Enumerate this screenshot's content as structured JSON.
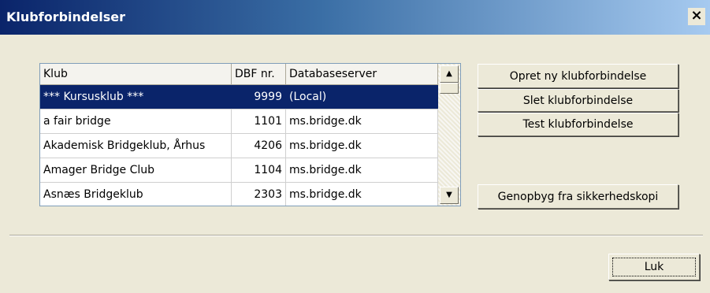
{
  "window": {
    "title": "Klubforbindelser",
    "close_glyph": "×"
  },
  "list": {
    "headers": [
      "Klub",
      "DBF nr.",
      "Databaseserver"
    ],
    "rows": [
      {
        "klub": "*** Kursusklub ***",
        "dbf": "9999",
        "server": "(Local)"
      },
      {
        "klub": "a fair bridge",
        "dbf": "1101",
        "server": "ms.bridge.dk"
      },
      {
        "klub": "Akademisk Bridgeklub, Århus",
        "dbf": "4206",
        "server": "ms.bridge.dk"
      },
      {
        "klub": "Amager Bridge Club",
        "dbf": "1104",
        "server": "ms.bridge.dk"
      },
      {
        "klub": "Asnæs Bridgeklub",
        "dbf": "2303",
        "server": "ms.bridge.dk"
      }
    ],
    "selected_index": 0
  },
  "buttons": {
    "create": "Opret ny klubforbindelse",
    "delete": "Slet klubforbindelse",
    "test": "Test klubforbindelse",
    "rebuild": "Genopbyg fra sikkerhedskopi",
    "close": "Luk"
  },
  "scrollbar": {
    "up_glyph": "▲",
    "down_glyph": "▼"
  },
  "colors": {
    "selection": "#0a246a",
    "dialog_bg": "#ece9d8"
  }
}
